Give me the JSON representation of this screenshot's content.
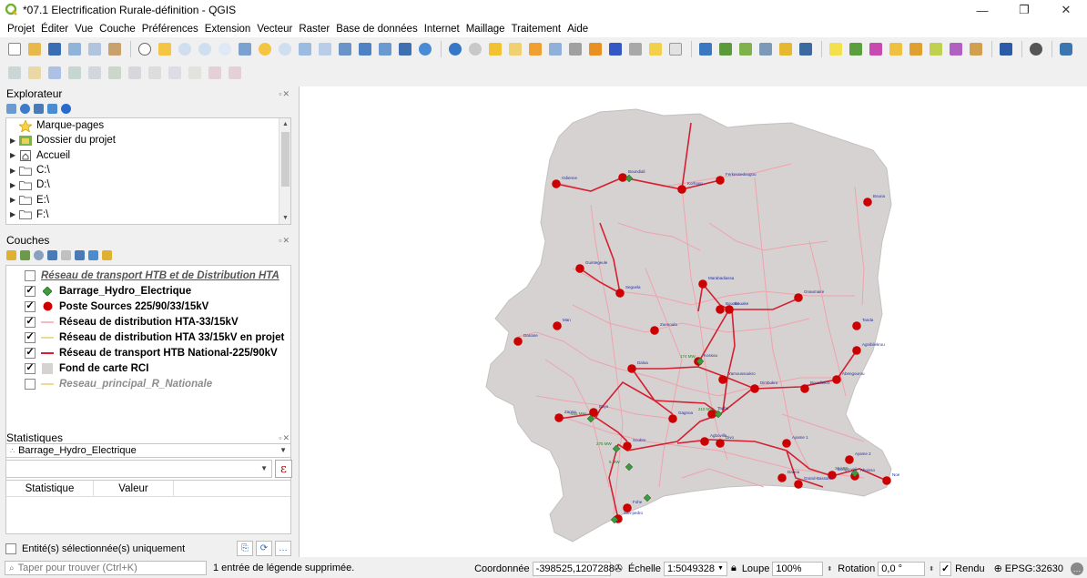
{
  "window": {
    "title": "*07.1 Electrification Rurale-définition - QGIS",
    "controls": [
      "—",
      "❐",
      "✕"
    ]
  },
  "menu": [
    "Projet",
    "Éditer",
    "Vue",
    "Couche",
    "Préférences",
    "Extension",
    "Vecteur",
    "Raster",
    "Base de données",
    "Internet",
    "Maillage",
    "Traitement",
    "Aide"
  ],
  "explorer": {
    "title": "Explorateur",
    "items": [
      {
        "label": "Marque-pages",
        "icon": "star-icon",
        "expand": false
      },
      {
        "label": "Dossier du projet",
        "icon": "project-folder-icon",
        "expand": true
      },
      {
        "label": "Accueil",
        "icon": "home-icon",
        "expand": true
      },
      {
        "label": "C:\\",
        "icon": "drive-icon",
        "expand": true
      },
      {
        "label": "D:\\",
        "icon": "drive-icon",
        "expand": true
      },
      {
        "label": "E:\\",
        "icon": "drive-icon",
        "expand": true
      },
      {
        "label": "F:\\",
        "icon": "drive-icon",
        "expand": true
      }
    ]
  },
  "layers": {
    "title": "Couches",
    "items": [
      {
        "label": "Réseau de transport HTB et de Distribution HTA",
        "checked": false,
        "symbol": "none",
        "style": "group"
      },
      {
        "label": "Barrage_Hydro_Electrique",
        "checked": true,
        "symbol": "green-diamond",
        "style": "bold"
      },
      {
        "label": "Poste Sources 225/90/33/15kV",
        "checked": true,
        "symbol": "red-circle",
        "style": "bold"
      },
      {
        "label": "Réseau de distribution HTA-33/15kV",
        "checked": true,
        "symbol": "pink-line",
        "style": "bold"
      },
      {
        "label": "Réseau de distribution HTA 33/15kV en projet",
        "checked": true,
        "symbol": "yellow-line",
        "style": "bold"
      },
      {
        "label": "Réseau de transport HTB National-225/90kV",
        "checked": true,
        "symbol": "red-line",
        "style": "bold"
      },
      {
        "label": "Fond de carte RCI",
        "checked": true,
        "symbol": "grey-fill",
        "style": "bold"
      },
      {
        "label": "Reseau_principal_R_Nationale",
        "checked": false,
        "symbol": "yellow-line",
        "style": "off"
      }
    ]
  },
  "statistics": {
    "title": "Statistiques",
    "layer": "Barrage_Hydro_Electrique",
    "expr_button": "ε",
    "columns": [
      "Statistique",
      "Valeur"
    ],
    "selected_only_label": "Entité(s) sélectionnée(s) uniquement"
  },
  "map": {
    "colors": {
      "land": "#d6d2d2",
      "distribution": "#f0a2ac",
      "transport": "#d42030",
      "substation": "#cc0000",
      "dam": "#3f9a3f",
      "label": "#2030a0"
    },
    "substations": [
      {
        "name": "Odienne"
      },
      {
        "name": "Boundiali"
      },
      {
        "name": "Korhogo"
      },
      {
        "name": "Ferkessedougou"
      },
      {
        "name": "Bouna"
      },
      {
        "name": "Guintegeule"
      },
      {
        "name": "Seguela"
      },
      {
        "name": "Marabadiassa"
      },
      {
        "name": "Bouake"
      },
      {
        "name": "Bouake"
      },
      {
        "name": "Gnaumaire"
      },
      {
        "name": "Tanda"
      },
      {
        "name": "Man"
      },
      {
        "name": "Danane"
      },
      {
        "name": "Zuenoula"
      },
      {
        "name": "Kossou"
      },
      {
        "name": "Daloa"
      },
      {
        "name": "Yamoussoukro"
      },
      {
        "name": "Agnibilekrou"
      },
      {
        "name": "Dimbokro"
      },
      {
        "name": "Bouaflekro"
      },
      {
        "name": "Abengourou"
      },
      {
        "name": "Zagne"
      },
      {
        "name": "Buyo"
      },
      {
        "name": "Gagnoa"
      },
      {
        "name": "Taabo"
      },
      {
        "name": "Soubre"
      },
      {
        "name": "Divo"
      },
      {
        "name": "Agboville"
      },
      {
        "name": "Ayame 1"
      },
      {
        "name": "Ayame 2"
      },
      {
        "name": "Bongo-vaji"
      },
      {
        "name": "Aboisso"
      },
      {
        "name": "Dabou"
      },
      {
        "name": "Grand-Bassam"
      },
      {
        "name": "Noe"
      },
      {
        "name": "Fohe"
      },
      {
        "name": "San-pedro"
      }
    ],
    "dams": [
      {
        "name": "",
        "mw": ""
      },
      {
        "name": "",
        "mw": "174 MW"
      },
      {
        "name": "",
        "mw": "165 MW"
      },
      {
        "name": "",
        "mw": "210 MW"
      },
      {
        "name": "",
        "mw": "275 MW"
      },
      {
        "name": "",
        "mw": "30 MW"
      },
      {
        "name": "",
        "mw": "5 MW"
      },
      {
        "name": "",
        "mw": ""
      },
      {
        "name": "",
        "mw": ""
      }
    ]
  },
  "status": {
    "locator_placeholder": "Taper pour trouver (Ctrl+K)",
    "message": "1 entrée de légende supprimée.",
    "coord_label": "Coordonnée",
    "coord_value": "-398525,1207288",
    "scale_label": "Échelle",
    "scale_value": "1:5049328",
    "magnifier_label": "Loupe",
    "magnifier_value": "100%",
    "rotation_label": "Rotation",
    "rotation_value": "0,0 °",
    "render_label": "Rendu",
    "crs": "EPSG:32630"
  }
}
